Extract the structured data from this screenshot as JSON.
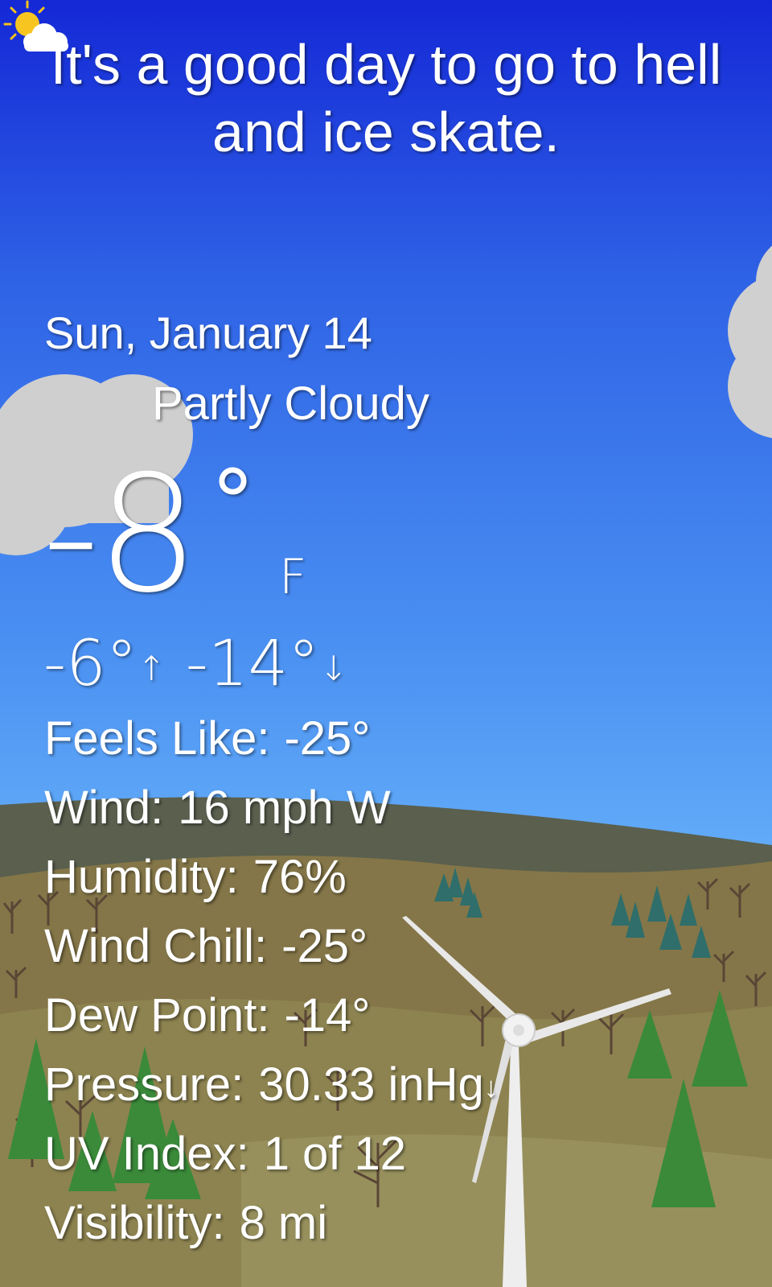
{
  "headline": "It's a good day to go to hell and ice skate.",
  "date": "Sun, January 14",
  "condition": {
    "icon": "partly-cloudy-icon",
    "text": "Partly Cloudy"
  },
  "temperature": {
    "current": "-8",
    "degree": "°",
    "unit": "F",
    "high": "-6°",
    "high_arrow": "↑",
    "low": "-14°",
    "low_arrow": "↓"
  },
  "details": {
    "feels_like": {
      "label": "Feels Like:",
      "value": "-25°"
    },
    "wind": {
      "label": "Wind:",
      "value": "16 mph W"
    },
    "humidity": {
      "label": "Humidity:",
      "value": "76%"
    },
    "wind_chill": {
      "label": "Wind Chill:",
      "value": "-25°"
    },
    "dew_point": {
      "label": "Dew Point:",
      "value": "-14°"
    },
    "pressure": {
      "label": "Pressure:",
      "value": "30.33 inHg",
      "trend": "↓"
    },
    "uv_index": {
      "label": "UV Index:",
      "value": "1 of 12"
    },
    "visibility": {
      "label": "Visibility:",
      "value": "8 mi"
    }
  },
  "colors": {
    "sky_top": "#1428d6",
    "sky_bottom": "#74b8f9",
    "hills_far": "#5a5f4e",
    "ground": "#8a7d4c",
    "tree_green": "#3a8a3a",
    "text": "#ffffff"
  }
}
